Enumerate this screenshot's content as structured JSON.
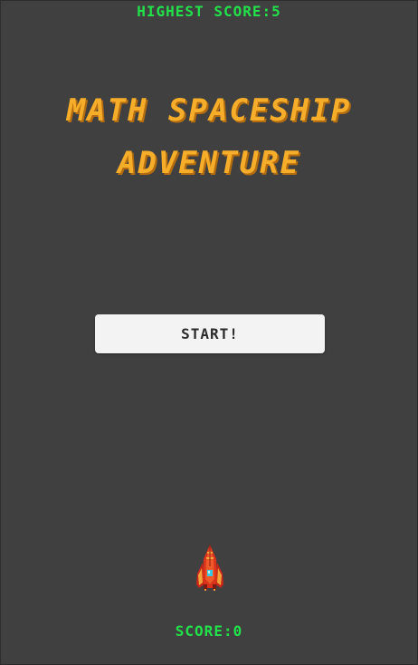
{
  "hud": {
    "highest_score_label": "HIGHEST SCORE:5",
    "score_label": "SCORE:0"
  },
  "title": {
    "line1": "MATH SPACESHIP",
    "line2": "ADVENTURE"
  },
  "menu": {
    "start_label": "START!"
  },
  "player": {
    "icon": "spaceship-icon"
  },
  "colors": {
    "background": "#404040",
    "hud_text": "#22e14a",
    "title_text": "#f6ad2a",
    "button_bg": "#f3f3f3",
    "ship_body": "#d9331b",
    "ship_accent": "#f2a33a",
    "ship_cockpit": "#35c7e8"
  }
}
